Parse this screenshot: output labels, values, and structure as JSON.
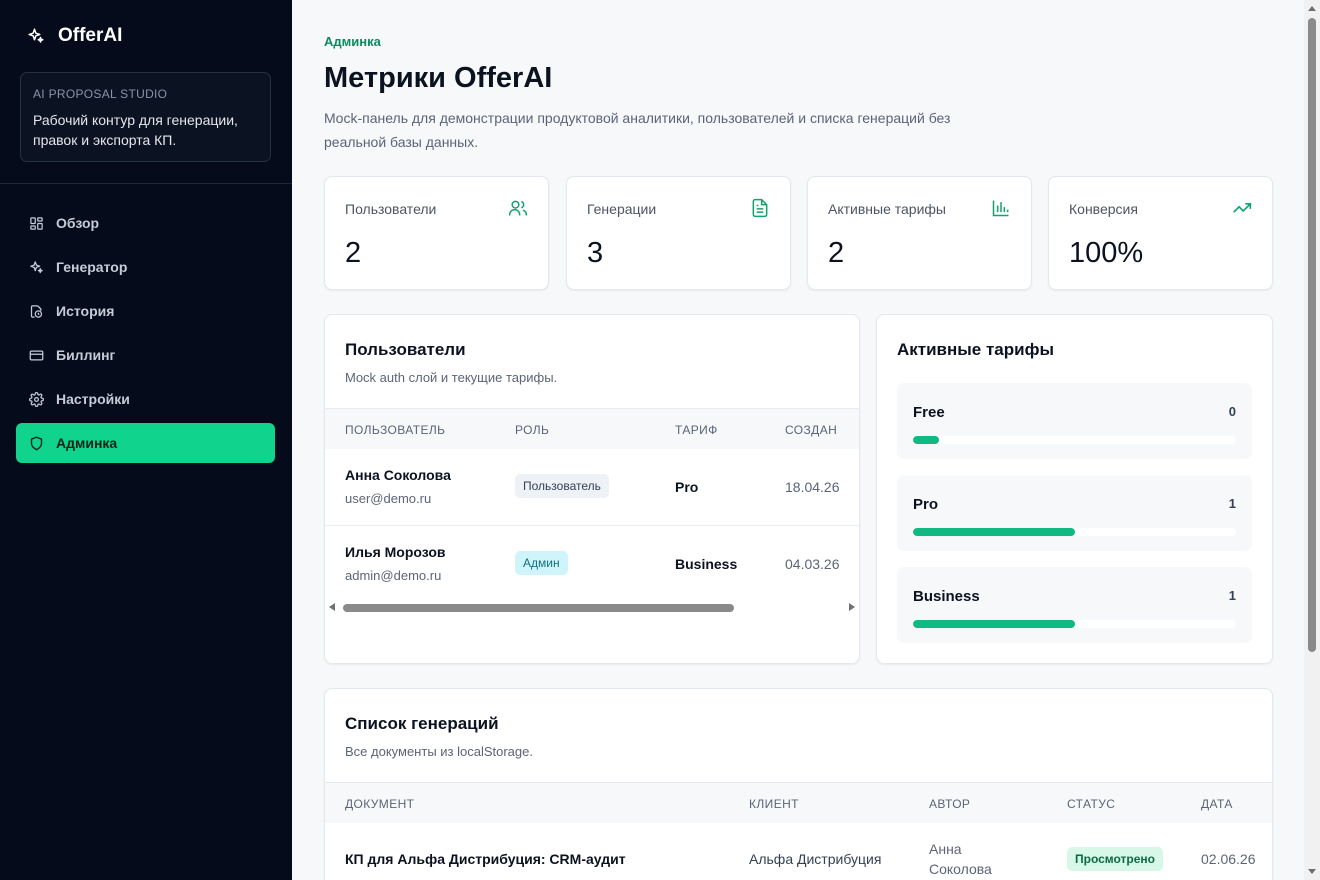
{
  "app": {
    "name": "OfferAI",
    "brand_icon": "sparkles-icon"
  },
  "sidebar": {
    "studio_kicker": "AI PROPOSAL STUDIO",
    "studio_text": "Рабочий контур для генерации, правок и экспорта КП.",
    "items": [
      {
        "label": "Обзор",
        "icon": "grid-icon"
      },
      {
        "label": "Генератор",
        "icon": "sparkles-icon"
      },
      {
        "label": "История",
        "icon": "history-icon"
      },
      {
        "label": "Биллинг",
        "icon": "credit-card-icon"
      },
      {
        "label": "Настройки",
        "icon": "gear-icon"
      },
      {
        "label": "Админка",
        "icon": "shield-icon",
        "active": true
      }
    ]
  },
  "header": {
    "breadcrumb": "Админка",
    "title": "Метрики OfferAI",
    "description": "Mock-панель для демонстрации продуктовой аналитики, пользователей и списка генераций без реальной базы данных."
  },
  "stats": [
    {
      "label": "Пользователи",
      "value": "2",
      "icon": "users-icon"
    },
    {
      "label": "Генерации",
      "value": "3",
      "icon": "document-icon"
    },
    {
      "label": "Активные тарифы",
      "value": "2",
      "icon": "bar-chart-icon"
    },
    {
      "label": "Конверсия",
      "value": "100%",
      "icon": "trending-up-icon"
    }
  ],
  "users_card": {
    "title": "Пользователи",
    "subtitle": "Mock auth слой и текущие тарифы.",
    "columns": [
      "ПОЛЬЗОВАТЕЛЬ",
      "РОЛЬ",
      "ТАРИФ",
      "СОЗДАН"
    ],
    "rows": [
      {
        "name": "Анна Соколова",
        "email": "user@demo.ru",
        "role": "Пользователь",
        "plan": "Pro",
        "created": "18.04.26"
      },
      {
        "name": "Илья Морозов",
        "email": "admin@demo.ru",
        "role": "Админ",
        "plan": "Business",
        "created": "04.03.26"
      }
    ]
  },
  "plans_card": {
    "title": "Активные тарифы",
    "plans": [
      {
        "name": "Free",
        "count": "0",
        "fill": 0.08
      },
      {
        "name": "Pro",
        "count": "1",
        "fill": 0.5
      },
      {
        "name": "Business",
        "count": "1",
        "fill": 0.5
      }
    ],
    "accent": "#10b981"
  },
  "generations_card": {
    "title": "Список генераций",
    "subtitle": "Все документы из localStorage.",
    "columns": [
      "ДОКУМЕНТ",
      "КЛИЕНТ",
      "АВТОР",
      "СТАТУС",
      "ДАТА"
    ],
    "rows": [
      {
        "document": "КП для Альфа Дистрибуция: CRM-аудит",
        "client": "Альфа Дистрибуция",
        "author_line1": "Анна",
        "author_line2": "Соколова",
        "status": "Просмотрено",
        "date": "02.06.26"
      }
    ]
  },
  "colors": {
    "sidebar_bg": "#050b1a",
    "accent": "#10d48e",
    "brand_green": "#0f8a5f"
  }
}
